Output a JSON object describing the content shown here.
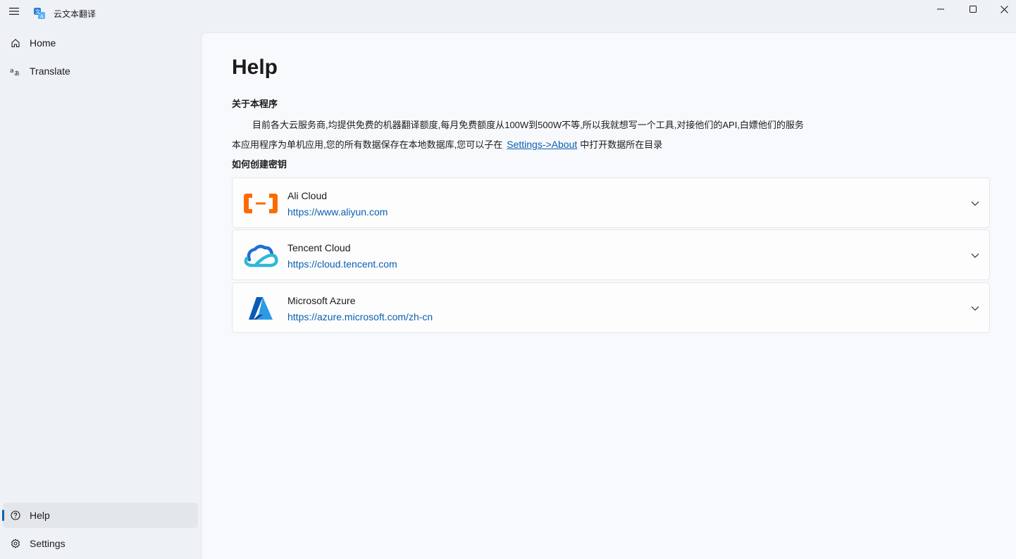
{
  "app": {
    "title": "云文本翻译"
  },
  "sidebar": {
    "items": [
      {
        "label": "Home",
        "icon": "home-icon"
      },
      {
        "label": "Translate",
        "icon": "translate-icon"
      }
    ],
    "footer_items": [
      {
        "label": "Help",
        "icon": "help-icon",
        "selected": true
      },
      {
        "label": "Settings",
        "icon": "gear-icon"
      }
    ]
  },
  "main": {
    "title": "Help",
    "about": {
      "heading": "关于本程序",
      "para1": "目前各大云服务商,均提供免费的机器翻译额度,每月免费额度从100W到500W不等,所以我就想写一个工具,对接他们的API,白嫖他们的服务",
      "para2_before": "本应用程序为单机应用,您的所有数据保存在本地数据库,您可以子在",
      "para2_link": "Settings->About",
      "para2_after": "中打开数据所在目录"
    },
    "keys": {
      "heading": "如何创建密钥",
      "providers": [
        {
          "name": "Ali Cloud",
          "url": "https://www.aliyun.com",
          "icon": "aliyun-logo-icon"
        },
        {
          "name": "Tencent Cloud",
          "url": "https://cloud.tencent.com",
          "icon": "tencent-cloud-logo-icon"
        },
        {
          "name": "Microsoft Azure",
          "url": "https://azure.microsoft.com/zh-cn",
          "icon": "azure-logo-icon"
        }
      ]
    }
  },
  "colors": {
    "accent": "#0a64b4",
    "link": "#0a5fb0",
    "ali_orange": "#ff6a00",
    "tencent_blue": "#1a7ce0",
    "azure_blue": "#0078d4"
  }
}
